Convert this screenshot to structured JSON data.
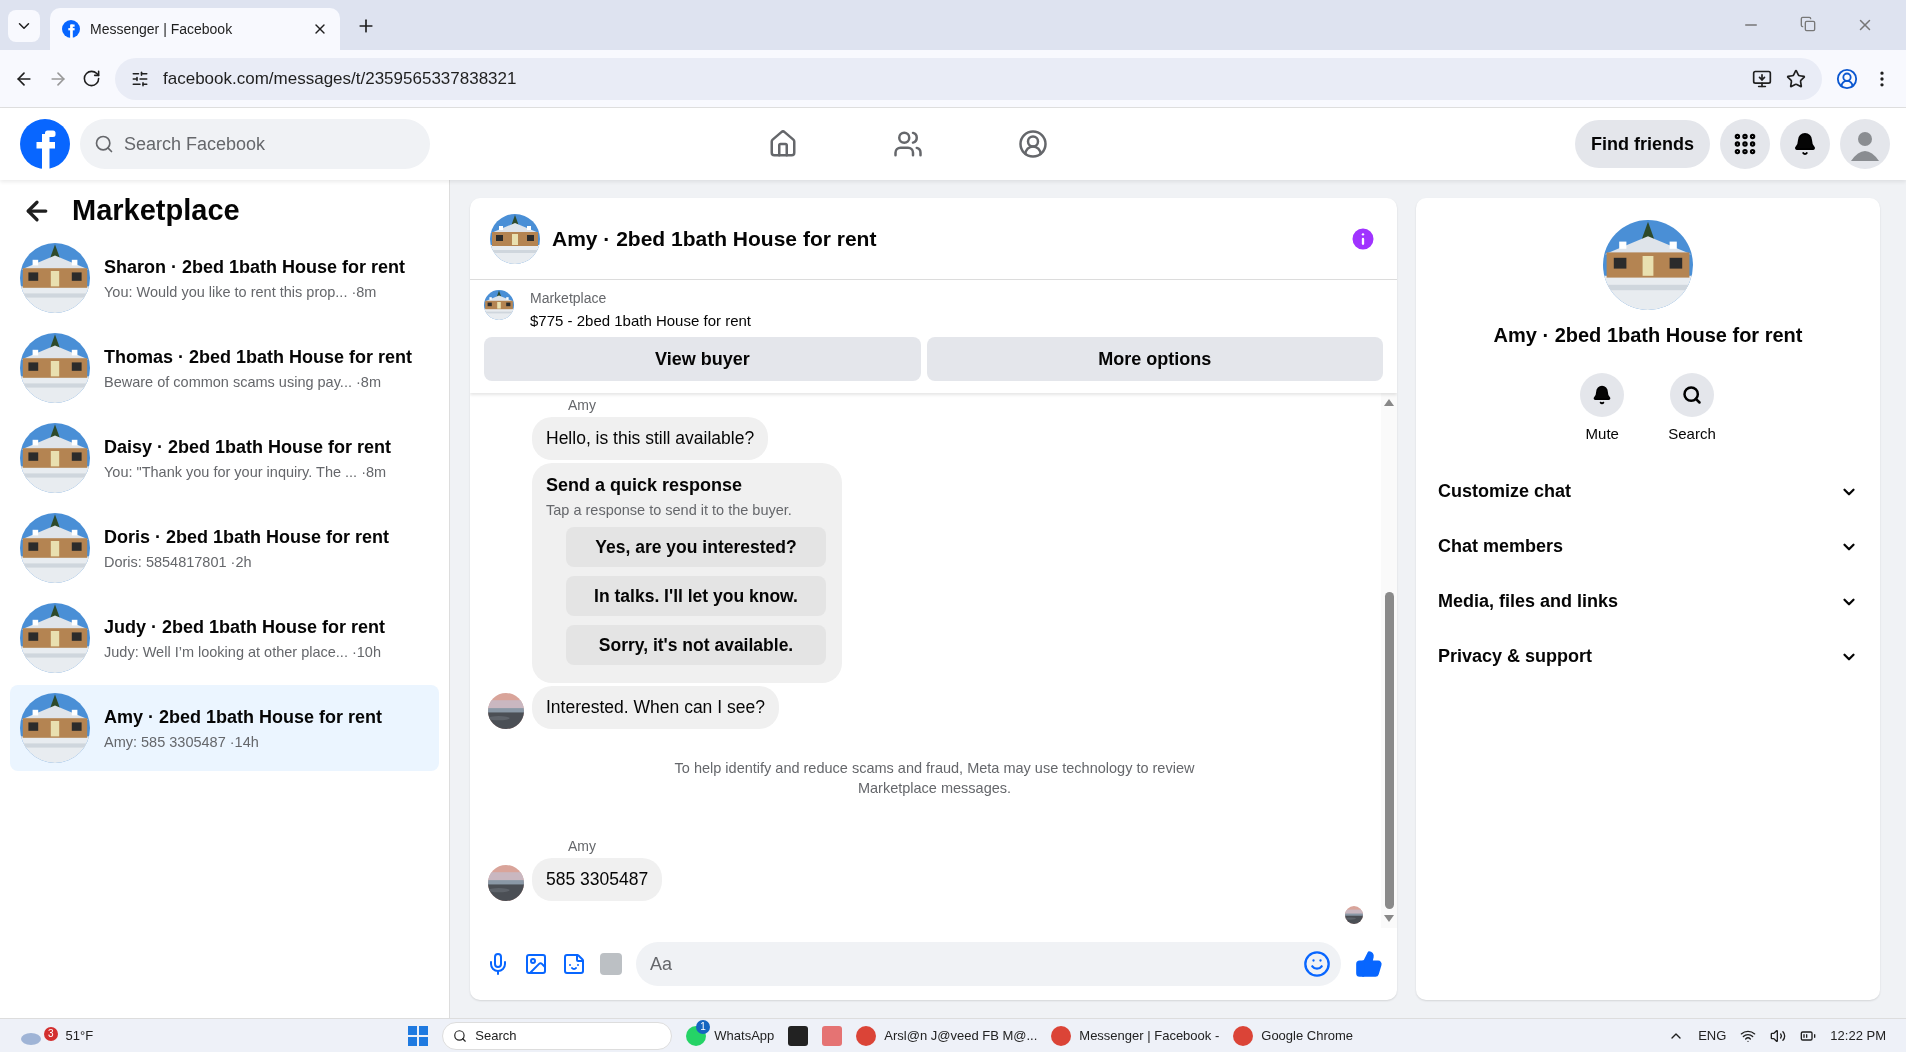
{
  "browser": {
    "tab_title": "Messenger | Facebook",
    "url": "facebook.com/messages/t/2359565337838321"
  },
  "header": {
    "search_placeholder": "Search Facebook",
    "find_friends": "Find friends"
  },
  "sidebar": {
    "title": "Marketplace",
    "conversations": [
      {
        "name": "Sharon · 2bed 1bath House for rent",
        "preview": "You: Would you like to rent this prop...",
        "time": "·8m",
        "selected": false
      },
      {
        "name": "Thomas · 2bed 1bath House for rent",
        "preview": "Beware of common scams using pay...",
        "time": "·8m",
        "selected": false
      },
      {
        "name": "Daisy · 2bed 1bath House for rent",
        "preview": "You: \"Thank you for your inquiry. The ...",
        "time": "·8m",
        "selected": false
      },
      {
        "name": "Doris · 2bed 1bath House for rent",
        "preview": "Doris: 5854817801",
        "time": "·2h",
        "selected": false
      },
      {
        "name": "Judy · 2bed 1bath House for rent",
        "preview": "Judy: Well I’m looking at other place...",
        "time": "·10h",
        "selected": false
      },
      {
        "name": "Amy · 2bed 1bath House for rent",
        "preview": "Amy: 585 3305487",
        "time": "·14h",
        "selected": true
      }
    ]
  },
  "chat": {
    "title": "Amy · 2bed 1bath House for rent",
    "listing": {
      "source": "Marketplace",
      "item": "$775 - 2bed 1bath House for rent"
    },
    "actions": [
      "View buyer",
      "More options"
    ],
    "messages": [
      {
        "kind": "sender",
        "text": "Amy"
      },
      {
        "kind": "bubble",
        "text": "Hello, is this still available?",
        "avatar": false
      },
      {
        "kind": "quick_response",
        "title": "Send a quick response",
        "subtitle": "Tap a response to send it to the buyer.",
        "options": [
          "Yes, are you interested?",
          "In talks. I'll let you know.",
          "Sorry, it's not available."
        ]
      },
      {
        "kind": "bubble",
        "text": "Interested. When can I see?",
        "avatar": true
      },
      {
        "kind": "notice",
        "text": "To help identify and reduce scams and fraud, Meta may use technology to review Marketplace messages."
      },
      {
        "kind": "sender",
        "text": "Amy"
      },
      {
        "kind": "bubble",
        "text": "585 3305487",
        "avatar": true
      }
    ],
    "composer": {
      "placeholder": "Aa"
    }
  },
  "details": {
    "title": "Amy · 2bed 1bath House for rent",
    "actions": [
      {
        "kind": "mute",
        "label": "Mute"
      },
      {
        "kind": "search",
        "label": "Search"
      }
    ],
    "sections": [
      {
        "label": "Customize chat",
        "expanded": false
      },
      {
        "label": "Chat members",
        "expanded": false
      },
      {
        "label": "Media, files and links",
        "expanded": false
      },
      {
        "label": "Privacy & support",
        "expanded": false
      }
    ]
  },
  "taskbar": {
    "weather_badge": "3",
    "temperature": "51°F",
    "search_placeholder": "Search",
    "apps": [
      {
        "kind": "whatsapp",
        "label": "WhatsApp",
        "badge": "1"
      },
      {
        "kind": "dark"
      },
      {
        "kind": "doc"
      },
      {
        "kind": "chrome",
        "label": "Arsl@n J@veed FB M@..."
      },
      {
        "kind": "chrome",
        "label": "Messenger | Facebook -"
      },
      {
        "kind": "chrome",
        "label": "Google Chrome"
      }
    ],
    "language": "ENG",
    "time": "12:22 PM"
  }
}
